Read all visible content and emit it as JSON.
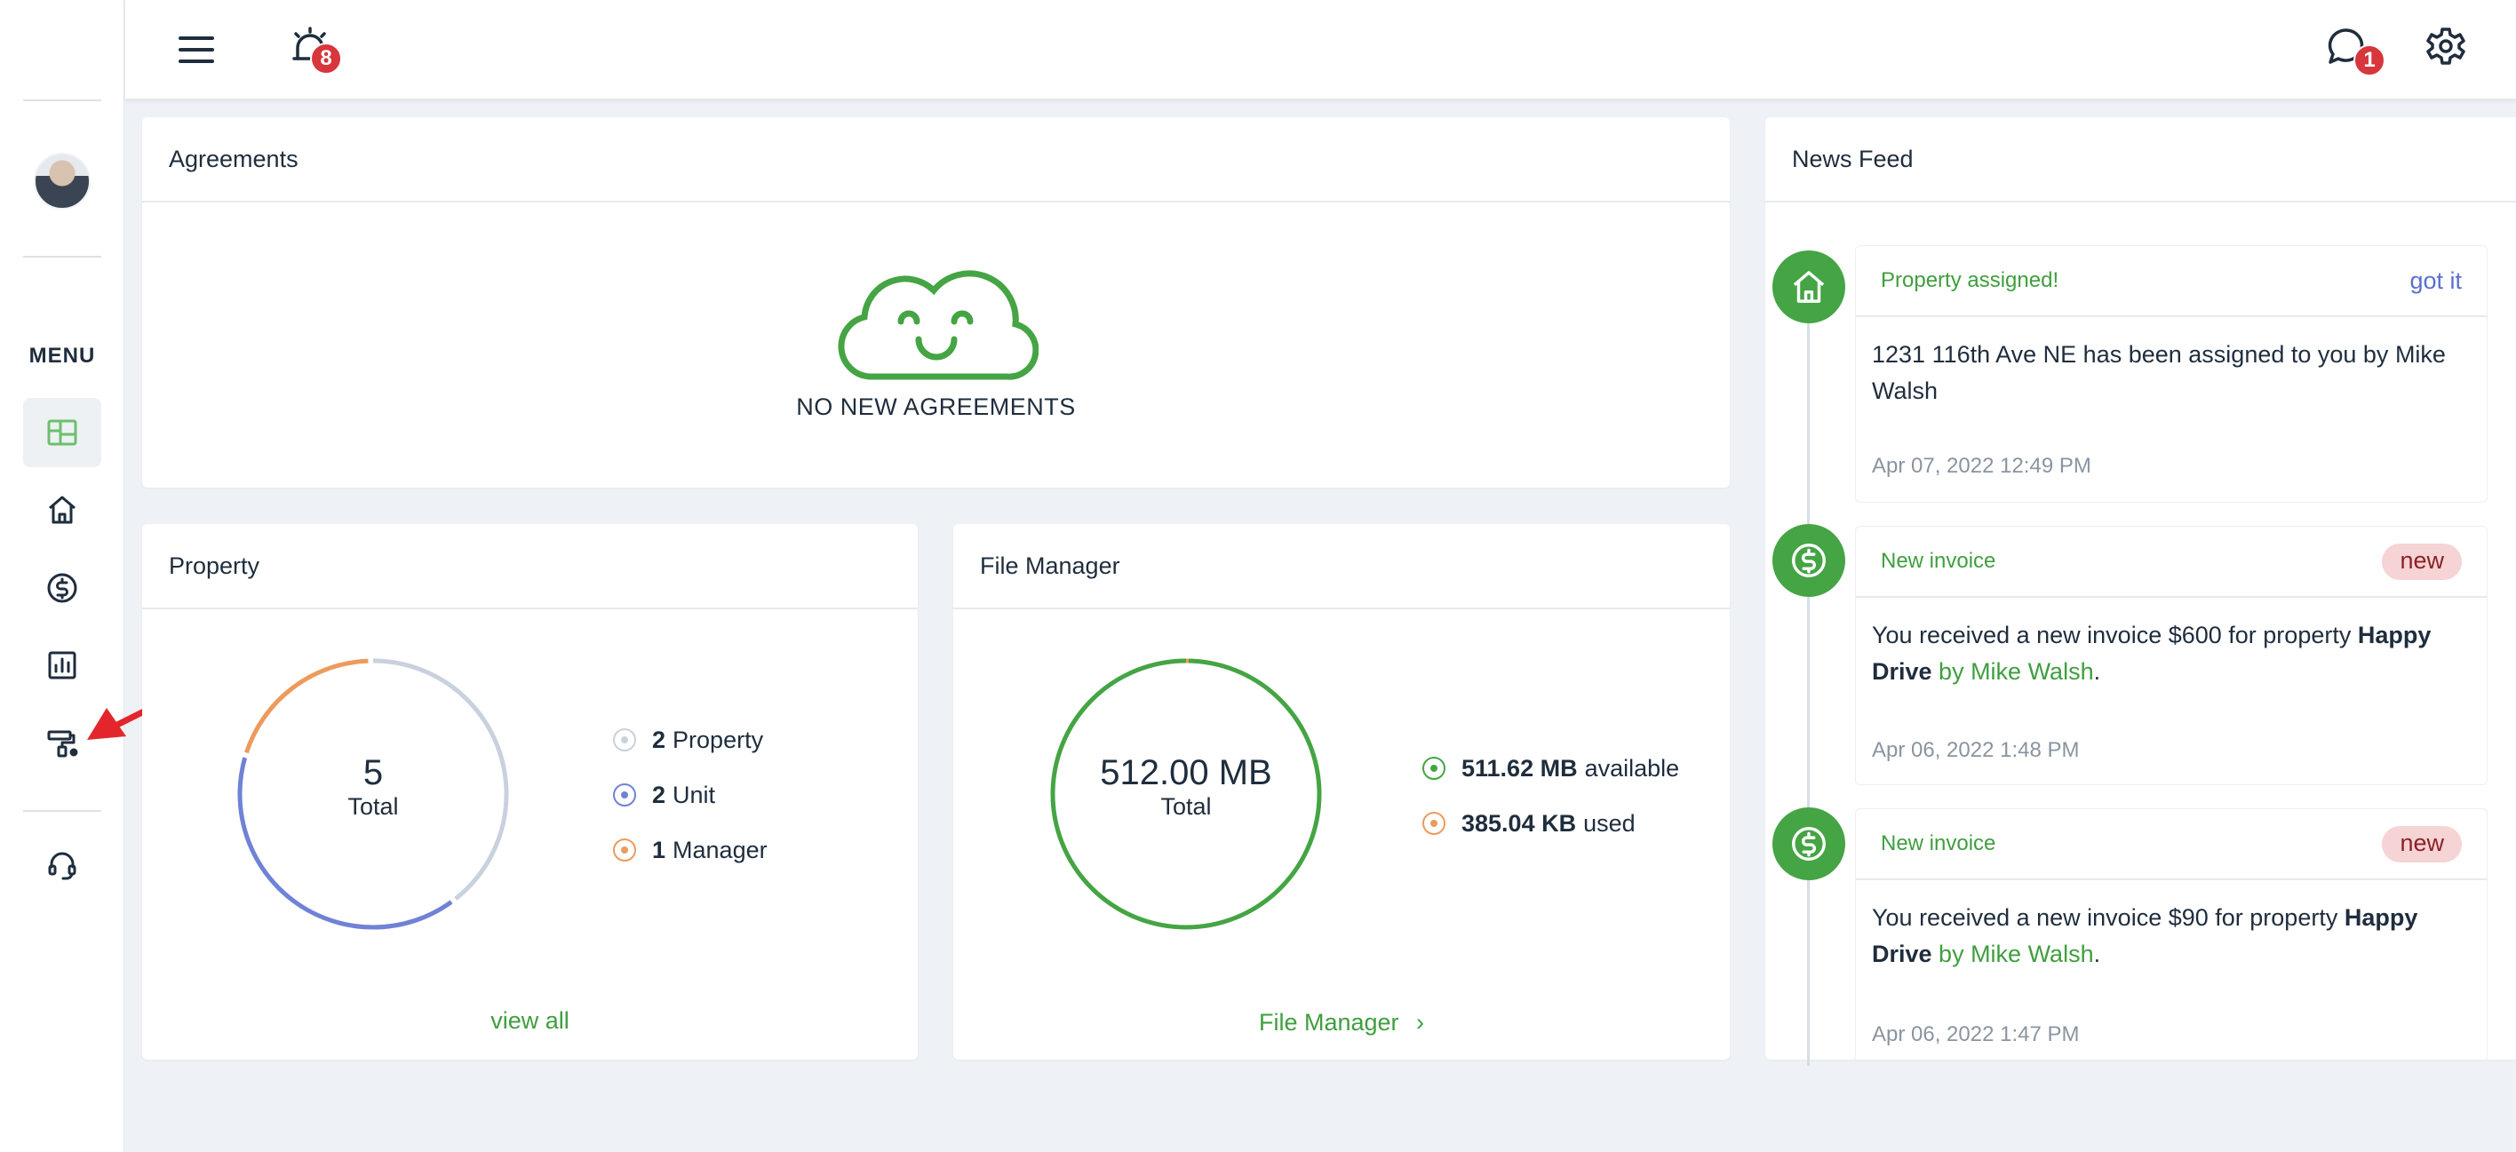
{
  "sidebar": {
    "menu_label": "MENU",
    "items": [
      {
        "name": "dashboard",
        "icon": "dashboard-icon",
        "active": true
      },
      {
        "name": "properties",
        "icon": "home-icon"
      },
      {
        "name": "payments",
        "icon": "dollar-circle-icon"
      },
      {
        "name": "reports",
        "icon": "bar-chart-icon"
      },
      {
        "name": "maintenance",
        "icon": "paint-roller-icon"
      },
      {
        "name": "support",
        "icon": "headset-icon"
      }
    ]
  },
  "topbar": {
    "notifications_badge": "8",
    "messages_badge": "1"
  },
  "agreements": {
    "title": "Agreements",
    "empty_text": "NO NEW AGREEMENTS"
  },
  "property": {
    "title": "Property",
    "total_value": "5",
    "total_label": "Total",
    "legend": [
      {
        "count": "2",
        "label": "Property",
        "color": "#c9d1de"
      },
      {
        "count": "2",
        "label": "Unit",
        "color": "#6f82d6"
      },
      {
        "count": "1",
        "label": "Manager",
        "color": "#ee9a5c"
      }
    ],
    "link": "view all"
  },
  "file_manager": {
    "title": "File Manager",
    "total_value": "512.00 MB",
    "total_label": "Total",
    "legend": [
      {
        "amount": "511.62 MB",
        "label": "available",
        "color": "#45a444"
      },
      {
        "amount": "385.04 KB",
        "label": "used",
        "color": "#ee9a5c"
      }
    ],
    "link": "File Manager",
    "link_chevron": "›"
  },
  "news_feed": {
    "title": "News Feed",
    "items": [
      {
        "icon": "home-icon",
        "title": "Property assigned!",
        "action": "got it",
        "body": "1231 116th Ave NE has been assigned to you by Mike Walsh",
        "time": "Apr 07, 2022 12:49 PM"
      },
      {
        "icon": "dollar-circle-icon",
        "title": "New invoice",
        "tag": "new",
        "body_prefix": "You received a new invoice $600 for property ",
        "body_bold": "Happy Drive",
        "body_by": " by Mike Walsh",
        "body_suffix": ".",
        "time": "Apr 06, 2022 1:48 PM"
      },
      {
        "icon": "dollar-circle-icon",
        "title": "New invoice",
        "tag": "new",
        "body_prefix": "You received a new invoice $90 for property ",
        "body_bold": "Happy Drive",
        "body_by": " by Mike Walsh",
        "body_suffix": ".",
        "time": "Apr 06, 2022 1:47 PM"
      }
    ]
  },
  "colors": {
    "brand_green": "#45a444",
    "accent_blue": "#6f82d6",
    "accent_orange": "#ee9a5c",
    "badge_red": "#d7363c"
  }
}
